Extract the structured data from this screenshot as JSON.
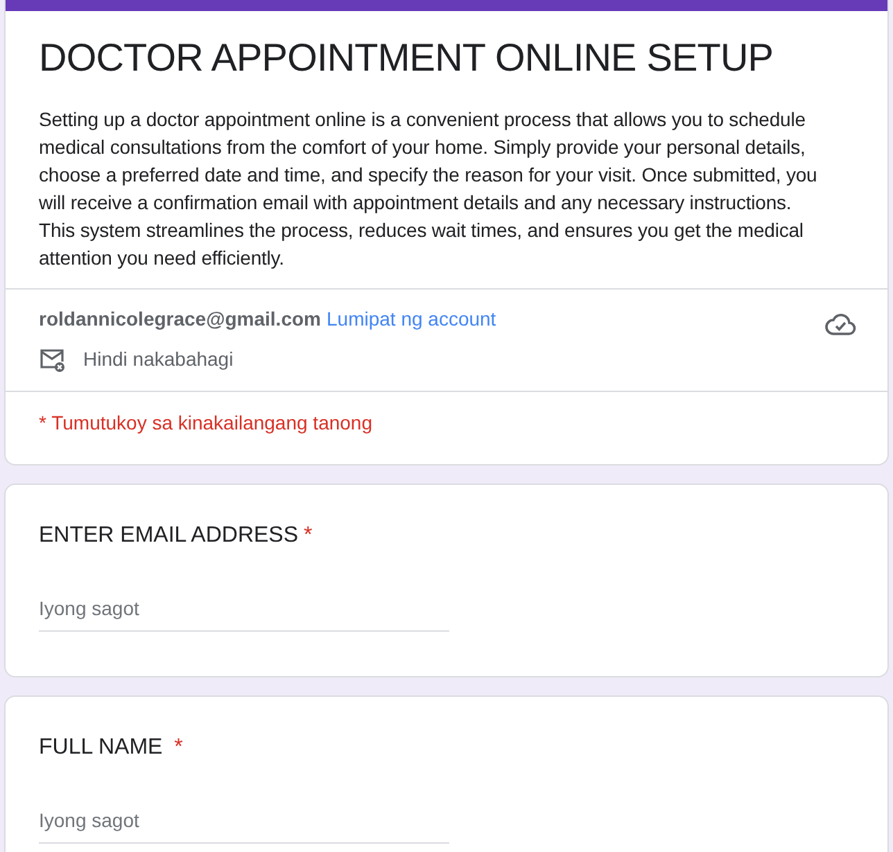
{
  "header": {
    "title": "DOCTOR APPOINTMENT ONLINE SETUP",
    "description": "Setting up a doctor appointment online is a convenient process that allows you to schedule medical consultations from the comfort of your home. Simply provide your personal details, choose a preferred date and time, and specify the reason for your visit. Once submitted, you will receive a confirmation email with appointment details and any necessary instructions. This system streamlines the process, reduces wait times, and ensures you get the medical attention you need efficiently.",
    "account_email": "roldannicolegrace@gmail.com",
    "switch_account_link": "Lumipat ng account",
    "sharing_status": "Hindi nakabahagi",
    "required_note": "* Tumutukoy sa kinakailangang tanong"
  },
  "questions": [
    {
      "title": "ENTER EMAIL ADDRESS",
      "required_mark": "*",
      "placeholder": "Iyong sagot"
    },
    {
      "title": "FULL NAME ",
      "required_mark": "*",
      "placeholder": "Iyong sagot"
    }
  ]
}
